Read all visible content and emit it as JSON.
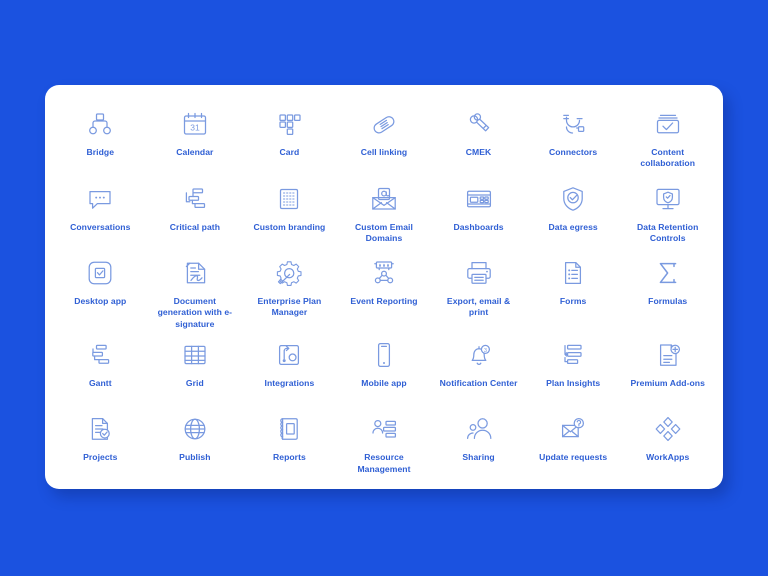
{
  "page": {
    "background_color": "#1b52e0",
    "card_color": "#ffffff",
    "label_color": "#2f5fd4",
    "icon_stroke_color": "#7a9ae0",
    "columns": 7,
    "rows": 5
  },
  "icons": [
    {
      "label": "Bridge",
      "icon": "bridge-icon"
    },
    {
      "label": "Calendar",
      "icon": "calendar-icon"
    },
    {
      "label": "Card",
      "icon": "card-icon"
    },
    {
      "label": "Cell linking",
      "icon": "link-icon"
    },
    {
      "label": "CMEK",
      "icon": "keys-icon"
    },
    {
      "label": "Connectors",
      "icon": "plug-icon"
    },
    {
      "label": "Content collaboration",
      "icon": "checkbox-folder-icon"
    },
    {
      "label": "Conversations",
      "icon": "speech-bubble-icon"
    },
    {
      "label": "Critical path",
      "icon": "critical-path-icon"
    },
    {
      "label": "Custom branding",
      "icon": "branding-grid-icon"
    },
    {
      "label": "Custom Email Domains",
      "icon": "email-at-icon"
    },
    {
      "label": "Dashboards",
      "icon": "dashboard-layout-icon"
    },
    {
      "label": "Data egress",
      "icon": "shield-check-icon"
    },
    {
      "label": "Data Retention Controls",
      "icon": "monitor-shield-icon"
    },
    {
      "label": "Desktop app",
      "icon": "desktop-app-icon"
    },
    {
      "label": "Document generation with e-signature",
      "icon": "document-signature-icon"
    },
    {
      "label": "Enterprise Plan Manager",
      "icon": "gear-wrench-icon"
    },
    {
      "label": "Event Reporting",
      "icon": "event-reporting-icon"
    },
    {
      "label": "Export, email & print",
      "icon": "printer-icon"
    },
    {
      "label": "Forms",
      "icon": "form-document-icon"
    },
    {
      "label": "Formulas",
      "icon": "sigma-icon"
    },
    {
      "label": "Gantt",
      "icon": "gantt-icon"
    },
    {
      "label": "Grid",
      "icon": "grid-table-icon"
    },
    {
      "label": "Integrations",
      "icon": "integrations-icon"
    },
    {
      "label": "Mobile app",
      "icon": "mobile-phone-icon"
    },
    {
      "label": "Notification Center",
      "icon": "bell-badge-icon"
    },
    {
      "label": "Plan Insights",
      "icon": "plan-insights-icon"
    },
    {
      "label": "Premium Add-ons",
      "icon": "document-plus-icon"
    },
    {
      "label": "Projects",
      "icon": "project-check-icon"
    },
    {
      "label": "Publish",
      "icon": "globe-icon"
    },
    {
      "label": "Reports",
      "icon": "reports-icon"
    },
    {
      "label": "Resource Management",
      "icon": "resource-management-icon"
    },
    {
      "label": "Sharing",
      "icon": "people-share-icon"
    },
    {
      "label": "Update requests",
      "icon": "envelope-question-icon"
    },
    {
      "label": "WorkApps",
      "icon": "diamond-cluster-icon"
    }
  ]
}
